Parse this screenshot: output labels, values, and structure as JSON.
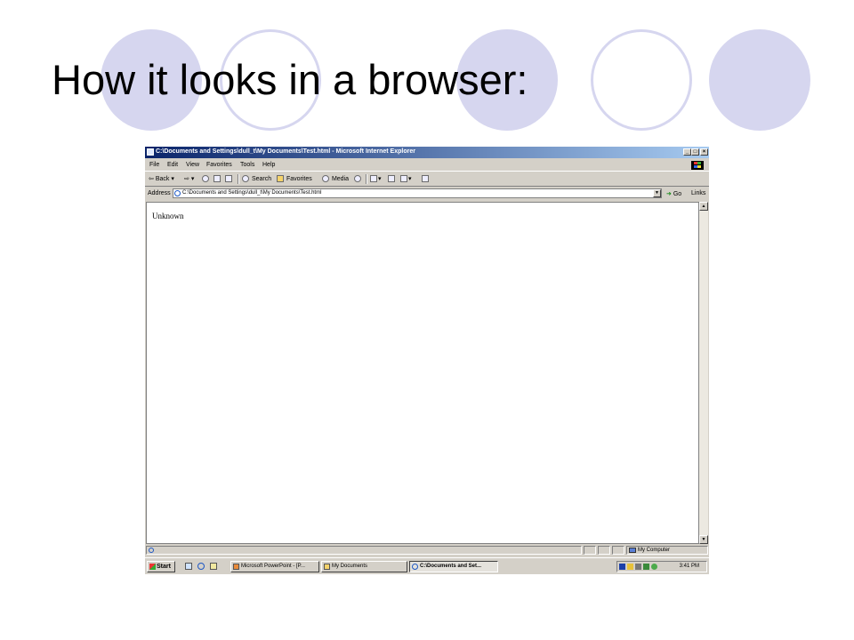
{
  "slide": {
    "title": "How it looks in a browser:"
  },
  "window": {
    "title": "C:\\Documents and Settings\\dull_t\\My Documents\\Test.html - Microsoft Internet Explorer",
    "controls": {
      "minimize": "_",
      "maximize": "□",
      "close": "×"
    }
  },
  "menu": {
    "items": [
      "File",
      "Edit",
      "View",
      "Favorites",
      "Tools",
      "Help"
    ]
  },
  "toolbar": {
    "back": "Back",
    "search": "Search",
    "favorites": "Favorites",
    "media": "Media"
  },
  "address": {
    "label": "Address",
    "value": "C:\\Documents and Settings\\dull_t\\My Documents\\Test.html",
    "go": "Go",
    "links": "Links"
  },
  "page": {
    "content_text": "Unknown"
  },
  "status": {
    "zone": "My Computer"
  },
  "taskbar": {
    "start": "Start",
    "buttons": [
      "Microsoft PowerPoint - [P...",
      "My Documents",
      "C:\\Documents and Set..."
    ],
    "clock": "3:41 PM"
  },
  "colors": {
    "circle": "#d6d6ef",
    "titlebar_start": "#0a246a",
    "titlebar_end": "#a6caf0",
    "chrome": "#d4d0c8"
  },
  "icons": [
    "ie-icon",
    "back-arrow-icon",
    "forward-arrow-icon",
    "stop-icon",
    "refresh-icon",
    "home-icon",
    "search-icon",
    "favorites-icon",
    "media-icon",
    "history-icon",
    "mail-icon",
    "print-icon",
    "edit-icon",
    "windows-logo-icon",
    "my-computer-icon"
  ]
}
